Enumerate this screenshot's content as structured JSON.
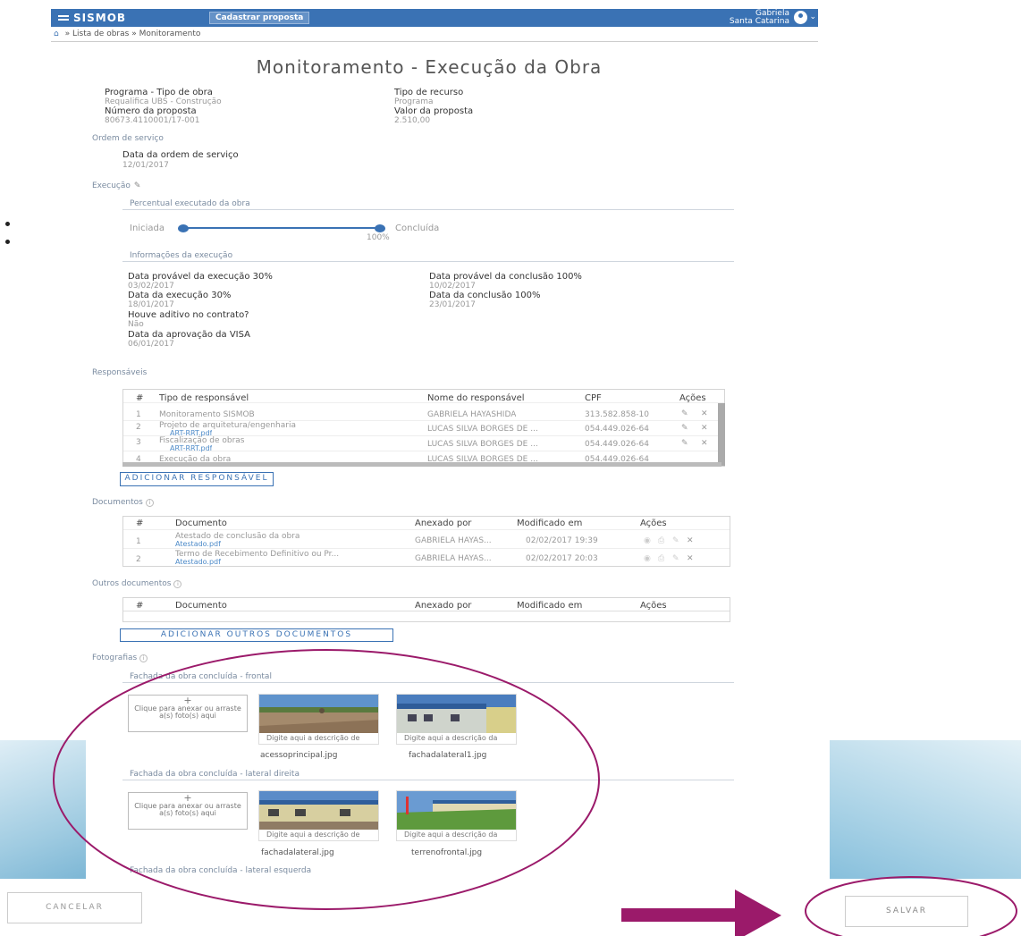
{
  "header": {
    "logo": "SISMOB",
    "cadastrar_label": "Cadastrar proposta",
    "user_name": "Gabriela",
    "user_location": "Santa Catarina"
  },
  "breadcrumb": {
    "sep1": "»",
    "item1": "Lista de obras",
    "sep2": "»",
    "item2": "Monitoramento"
  },
  "page_title": "Monitoramento - Execução da Obra",
  "summary": {
    "programa_label": "Programa - Tipo de obra",
    "programa_value": "Requalifica UBS - Construção",
    "tipo_recurso_label": "Tipo de recurso",
    "tipo_recurso_value": "Programa",
    "numero_label": "Número da proposta",
    "numero_value": "80673.4110001/17-001",
    "valor_label": "Valor da proposta",
    "valor_value": "2.510,00"
  },
  "ordem_servico": {
    "title": "Ordem de serviço",
    "data_label": "Data da ordem de serviço",
    "data_value": "12/01/2017"
  },
  "execucao": {
    "title": "Execução",
    "percentual_title": "Percentual executado da obra",
    "iniciada": "Iniciada",
    "concluida": "Concluída",
    "percent_label": "100%",
    "progress": 1.0,
    "info_title": "Informações da execução",
    "dp30_label": "Data provável da execução 30%",
    "dp30_value": "03/02/2017",
    "dp100_label": "Data provável da conclusão 100%",
    "dp100_value": "10/02/2017",
    "de30_label": "Data da execução 30%",
    "de30_value": "18/01/2017",
    "dc100_label": "Data da conclusão 100%",
    "dc100_value": "23/01/2017",
    "aditivo_label": "Houve aditivo no contrato?",
    "aditivo_value": "Não",
    "visa_label": "Data da aprovação da VISA",
    "visa_value": "06/01/2017"
  },
  "responsaveis": {
    "title": "Responsáveis",
    "headers": {
      "num": "#",
      "tipo": "Tipo de responsável",
      "nome": "Nome do responsável",
      "cpf": "CPF",
      "acoes": "Ações"
    },
    "rows": [
      {
        "num": "1",
        "tipo": "Monitoramento SISMOB",
        "link": "",
        "nome": "GABRIELA HAYASHIDA",
        "cpf": "313.582.858-10"
      },
      {
        "num": "2",
        "tipo": "Projeto de arquitetura/engenharia",
        "link": "ART-RRT.pdf",
        "nome": "LUCAS SILVA BORGES DE ...",
        "cpf": "054.449.026-64"
      },
      {
        "num": "3",
        "tipo": "Fiscalização de obras",
        "link": "ART-RRT.pdf",
        "nome": "LUCAS SILVA BORGES DE ...",
        "cpf": "054.449.026-64"
      },
      {
        "num": "4",
        "tipo": "Execução da obra",
        "link": "",
        "nome": "LUCAS SILVA BORGES DE ...",
        "cpf": "054.449.026-64"
      }
    ],
    "add_label": "ADICIONAR RESPONSÁVEL"
  },
  "documentos": {
    "title": "Documentos",
    "headers": {
      "num": "#",
      "doc": "Documento",
      "anexado": "Anexado por",
      "modificado": "Modificado em",
      "acoes": "Ações"
    },
    "rows": [
      {
        "num": "1",
        "doc": "Atestado de conclusão da obra",
        "link": "Atestado.pdf",
        "anexado": "GABRIELA HAYAS...",
        "modificado": "02/02/2017 19:39"
      },
      {
        "num": "2",
        "doc": "Termo de Recebimento Definitivo ou Pr...",
        "link": "Atestado.pdf",
        "anexado": "GABRIELA HAYAS...",
        "modificado": "02/02/2017 20:03"
      }
    ]
  },
  "outros": {
    "title": "Outros documentos",
    "headers": {
      "num": "#",
      "doc": "Documento",
      "anexado": "Anexado por",
      "modificado": "Modificado em",
      "acoes": "Ações"
    },
    "add_label": "ADICIONAR OUTROS DOCUMENTOS"
  },
  "fotografias": {
    "title": "Fotografias",
    "group1_title": "Fachada da obra concluída - frontal",
    "group2_title": "Fachada da obra concluída - lateral direita",
    "group3_title": "Fachada da obra concluída - lateral esquerda",
    "drop_label": "Clique para anexar ou arraste a(s) foto(s) aqui",
    "caption_de": "Digite aqui a descrição de",
    "caption_da": "Digite aqui a descrição da",
    "g1_photo1": "acessoprincipal.jpg",
    "g1_photo2": "fachadalateral1.jpg",
    "g2_photo1": "fachadalateral.jpg",
    "g2_photo2": "terrenofrontal.jpg"
  },
  "footer": {
    "cancel_label": "CANCELAR",
    "save_label": "SALVAR"
  },
  "colors": {
    "primary": "#3a72b4",
    "annotation": "#9b1a6a"
  }
}
